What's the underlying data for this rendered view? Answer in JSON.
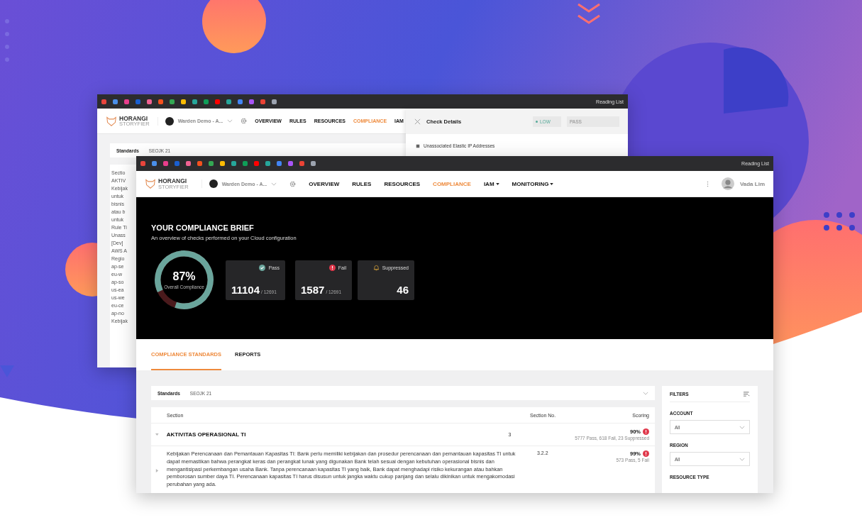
{
  "back_window": {
    "bookmarks_bar": {
      "reading_list": "Reading List"
    },
    "logo": {
      "name": "HORANGI",
      "product": "STORYFIER"
    },
    "account": "Warden Demo - A...",
    "nav": [
      {
        "label": "OVERVIEW",
        "selected": false
      },
      {
        "label": "RULES",
        "selected": false
      },
      {
        "label": "RESOURCES",
        "selected": false
      },
      {
        "label": "COMPLIANCE",
        "selected": true
      },
      {
        "label": "IAM",
        "selected": false
      }
    ],
    "standards": {
      "label": "Standards",
      "value": "SEOJK 21"
    },
    "visible_fragments": [
      "Sectio",
      "AKTIV",
      "Kebijak",
      "untuk",
      "bisnis",
      "atau b",
      "untuk",
      "Rule Ti",
      "Unass",
      "[Dev]",
      "AWS A",
      "Regio",
      "ap-se",
      "eu-w",
      "ap-so",
      "us-ea",
      "us-we",
      "eu-ce",
      "ap-no",
      "Kebijak"
    ],
    "check_details": {
      "title": "Check Details",
      "severity": "LOW",
      "status": "PASS",
      "item": "Unassociated Elastic IP Addresses"
    }
  },
  "window": {
    "bookmarks_bar": {
      "reading_list": "Reading List"
    },
    "logo": {
      "name": "HORANGI",
      "product": "STORYFIER"
    },
    "account": "Warden Demo - A...",
    "nav": [
      {
        "label": "OVERVIEW",
        "selected": false,
        "has_menu": false
      },
      {
        "label": "RULES",
        "selected": false,
        "has_menu": false
      },
      {
        "label": "RESOURCES",
        "selected": false,
        "has_menu": false
      },
      {
        "label": "COMPLIANCE",
        "selected": true,
        "has_menu": false
      },
      {
        "label": "IAM",
        "selected": false,
        "has_menu": true
      },
      {
        "label": "MONITORING",
        "selected": false,
        "has_menu": true
      }
    ],
    "user": "Vada Lim",
    "brief": {
      "title": "YOUR COMPLIANCE BRIEF",
      "subtitle": "An overview of checks performed on your Cloud configuration",
      "overall": {
        "value": "87%",
        "label": "Overall Compliance",
        "level": 0.87
      },
      "stats": [
        {
          "kind": "pass",
          "label": "Pass",
          "value": "11104",
          "total": "/ 12691"
        },
        {
          "kind": "fail",
          "label": "Fail",
          "value": "1587",
          "total": "/ 12691"
        },
        {
          "kind": "suppressed",
          "label": "Suppressed",
          "value": "46"
        }
      ]
    },
    "tabs": [
      {
        "label": "COMPLIANCE STANDARDS",
        "selected": true
      },
      {
        "label": "REPORTS",
        "selected": false
      }
    ],
    "standards": {
      "label": "Standards",
      "value": "SEOJK 21"
    },
    "table": {
      "columns": [
        "Section",
        "Section No.",
        "Scoring"
      ],
      "rows": [
        {
          "kind": "section",
          "expanded": true,
          "section": "AKTIVITAS OPERASIONAL TI",
          "number": "3",
          "score": "90%",
          "detail": "5777 Pass, 618 Fail, 23 Suppressed"
        },
        {
          "kind": "rule",
          "expanded": false,
          "section": "Kebijakan Perencanaan dan Pemantauan Kapasitas TI: Bank perlu memiliki kebijakan dan prosedur perencanaan dan pemantauan kapasitas TI untuk dapat memastikan bahwa perangkat keras dan perangkat lunak yang digunakan Bank telah sesuai dengan kebutuhan operasional bisnis dan mengantisipasi perkembangan usaha Bank. Tanpa perencanaan kapasitas TI yang baik, Bank dapat menghadapi risiko kekurangan atau bahkan pemborosan sumber daya TI. Perencanaan kapasitas TI harus disusun untuk jangka waktu cukup panjang dan selalu dikinikan untuk mengakomodasi perubahan yang ada.",
          "number": "3.2.2",
          "score": "99%",
          "detail": "573 Pass, 5 Fail"
        }
      ]
    },
    "filters": {
      "title": "FILTERS",
      "groups": [
        {
          "label": "ACCOUNT",
          "value": "All"
        },
        {
          "label": "REGION",
          "value": "All"
        },
        {
          "label": "RESOURCE TYPE"
        }
      ]
    }
  }
}
